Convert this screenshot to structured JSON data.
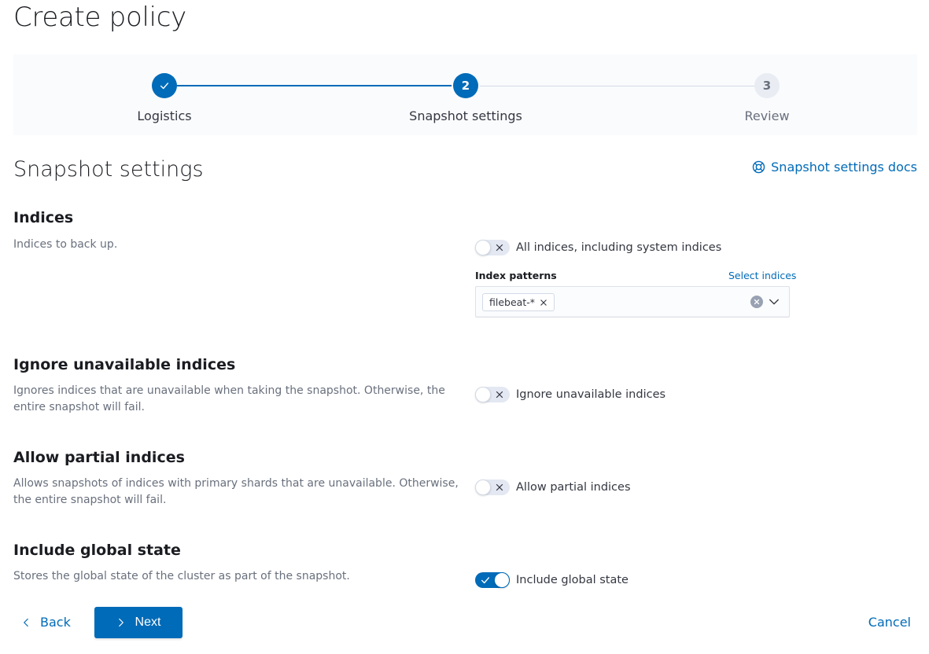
{
  "page": {
    "title": "Create policy"
  },
  "stepper": {
    "steps": [
      {
        "number": "1",
        "label": "Logistics",
        "status": "complete"
      },
      {
        "number": "2",
        "label": "Snapshot settings",
        "status": "current"
      },
      {
        "number": "3",
        "label": "Review",
        "status": "incomplete"
      }
    ]
  },
  "section": {
    "title": "Snapshot settings",
    "docs_link": "Snapshot settings docs",
    "docs_icon": "lifebuoy-icon"
  },
  "indices": {
    "title": "Indices",
    "description": "Indices to back up.",
    "toggle_label": "All indices, including system indices",
    "toggle_on": false,
    "patterns_label": "Index patterns",
    "select_link": "Select indices",
    "patterns": [
      "filebeat-*"
    ]
  },
  "ignore_unavailable": {
    "title": "Ignore unavailable indices",
    "description": "Ignores indices that are unavailable when taking the snapshot. Otherwise, the entire snapshot will fail.",
    "toggle_label": "Ignore unavailable indices",
    "toggle_on": false
  },
  "allow_partial": {
    "title": "Allow partial indices",
    "description": "Allows snapshots of indices with primary shards that are unavailable. Otherwise, the entire snapshot will fail.",
    "toggle_label": "Allow partial indices",
    "toggle_on": false
  },
  "include_global_state": {
    "title": "Include global state",
    "description": "Stores the global state of the cluster as part of the snapshot.",
    "toggle_label": "Include global state",
    "toggle_on": true
  },
  "footer": {
    "back_label": "Back",
    "next_label": "Next",
    "cancel_label": "Cancel"
  },
  "colors": {
    "primary": "#006bb8",
    "subdued_text": "#69707d",
    "stepper_bg": "#fafbfd"
  }
}
